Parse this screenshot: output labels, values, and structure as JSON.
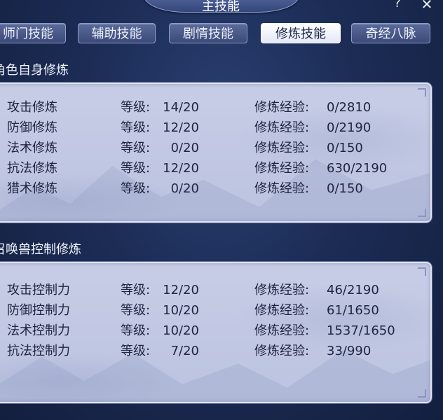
{
  "window": {
    "title": "主技能",
    "help_label": "?",
    "close_label": "✕"
  },
  "tabs": [
    {
      "label": "师门技能",
      "active": false
    },
    {
      "label": "辅助技能",
      "active": false
    },
    {
      "label": "剧情技能",
      "active": false
    },
    {
      "label": "修炼技能",
      "active": true
    },
    {
      "label": "奇经八脉",
      "active": false
    }
  ],
  "self_training": {
    "title": "角色自身修炼",
    "level_label": "等级:",
    "exp_label": "修炼经验:",
    "rows": [
      {
        "name": "攻击修炼",
        "level": "14/20",
        "exp": "0/2810"
      },
      {
        "name": "防御修炼",
        "level": "12/20",
        "exp": "0/2190"
      },
      {
        "name": "法术修炼",
        "level": "0/20",
        "exp": "0/150"
      },
      {
        "name": "抗法修炼",
        "level": "12/20",
        "exp": "630/2190"
      },
      {
        "name": "猎术修炼",
        "level": "0/20",
        "exp": "0/150"
      }
    ]
  },
  "pet_training": {
    "title": "召唤兽控制修炼",
    "level_label": "等级:",
    "exp_label": "修炼经验:",
    "rows": [
      {
        "name": "攻击控制力",
        "level": "12/20",
        "exp": "46/2190"
      },
      {
        "name": "防御控制力",
        "level": "10/20",
        "exp": "61/1650"
      },
      {
        "name": "法术控制力",
        "level": "10/20",
        "exp": "1537/1650"
      },
      {
        "name": "抗法控制力",
        "level": "7/20",
        "exp": "33/990"
      }
    ]
  },
  "colors": {
    "background": "#1c2c55",
    "panel": "#c3c9e4",
    "active_tab": "#ffffff",
    "text_dark": "#1f2440"
  }
}
